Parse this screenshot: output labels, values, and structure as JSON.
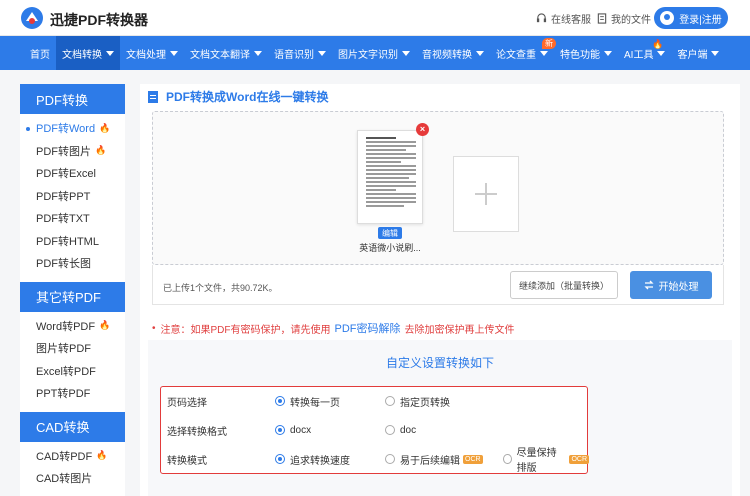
{
  "header": {
    "logo_text": "迅捷PDF转换器",
    "support": "在线客服",
    "my_files": "我的文件",
    "login": "登录|注册"
  },
  "nav": {
    "items": [
      {
        "label": "首页",
        "caret": false
      },
      {
        "label": "文档转换",
        "caret": true,
        "active": true
      },
      {
        "label": "文档处理",
        "caret": true
      },
      {
        "label": "文档文本翻译",
        "caret": true
      },
      {
        "label": "语音识别",
        "caret": true
      },
      {
        "label": "图片文字识别",
        "caret": true
      },
      {
        "label": "音视频转换",
        "caret": true
      },
      {
        "label": "论文查重",
        "caret": true,
        "badge": "新"
      },
      {
        "label": "特色功能",
        "caret": true
      },
      {
        "label": "AI工具",
        "caret": true,
        "fire": true
      },
      {
        "label": "客户端",
        "caret": true
      }
    ]
  },
  "sidebar": {
    "groups": [
      {
        "title": "PDF转换",
        "items": [
          {
            "label": "PDF转Word",
            "fire": true,
            "active": true
          },
          {
            "label": "PDF转图片",
            "fire": true
          },
          {
            "label": "PDF转Excel"
          },
          {
            "label": "PDF转PPT"
          },
          {
            "label": "PDF转TXT"
          },
          {
            "label": "PDF转HTML"
          },
          {
            "label": "PDF转长图"
          }
        ]
      },
      {
        "title": "其它转PDF",
        "items": [
          {
            "label": "Word转PDF",
            "fire": true
          },
          {
            "label": "图片转PDF"
          },
          {
            "label": "Excel转PDF"
          },
          {
            "label": "PPT转PDF"
          }
        ]
      },
      {
        "title": "CAD转换",
        "items": [
          {
            "label": "CAD转PDF",
            "fire": true
          },
          {
            "label": "CAD转图片"
          }
        ]
      }
    ]
  },
  "main": {
    "title": "PDF转换成Word在线一键转换",
    "file": {
      "name": "英语微小说刷...",
      "edit_label": "编辑"
    },
    "status": "已上传1个文件，共90.72K。",
    "continue_btn": "继续添加（批量转换）",
    "start_btn": "开始处理",
    "notice": {
      "prefix": "注意：如果PDF有密码保护，请先使用",
      "link": "PDF密码解除",
      "suffix": "去除加密保护再上传文件"
    },
    "settings": {
      "title": "自定义设置转换如下",
      "rows": [
        {
          "label": "页码选择",
          "options": [
            {
              "text": "转换每一页",
              "on": true
            },
            {
              "text": "指定页转换"
            }
          ]
        },
        {
          "label": "选择转换格式",
          "options": [
            {
              "text": "docx",
              "on": true
            },
            {
              "text": "doc"
            }
          ]
        },
        {
          "label": "转换模式",
          "options": [
            {
              "text": "追求转换速度",
              "on": true
            },
            {
              "text": "易于后续编辑",
              "tag": "OCR"
            },
            {
              "text": "尽量保持排版",
              "tag": "OCR"
            }
          ]
        }
      ]
    }
  },
  "colors": {
    "brand": "#2d7be8",
    "alert": "#e04040",
    "fire": "#ff5a2e"
  }
}
